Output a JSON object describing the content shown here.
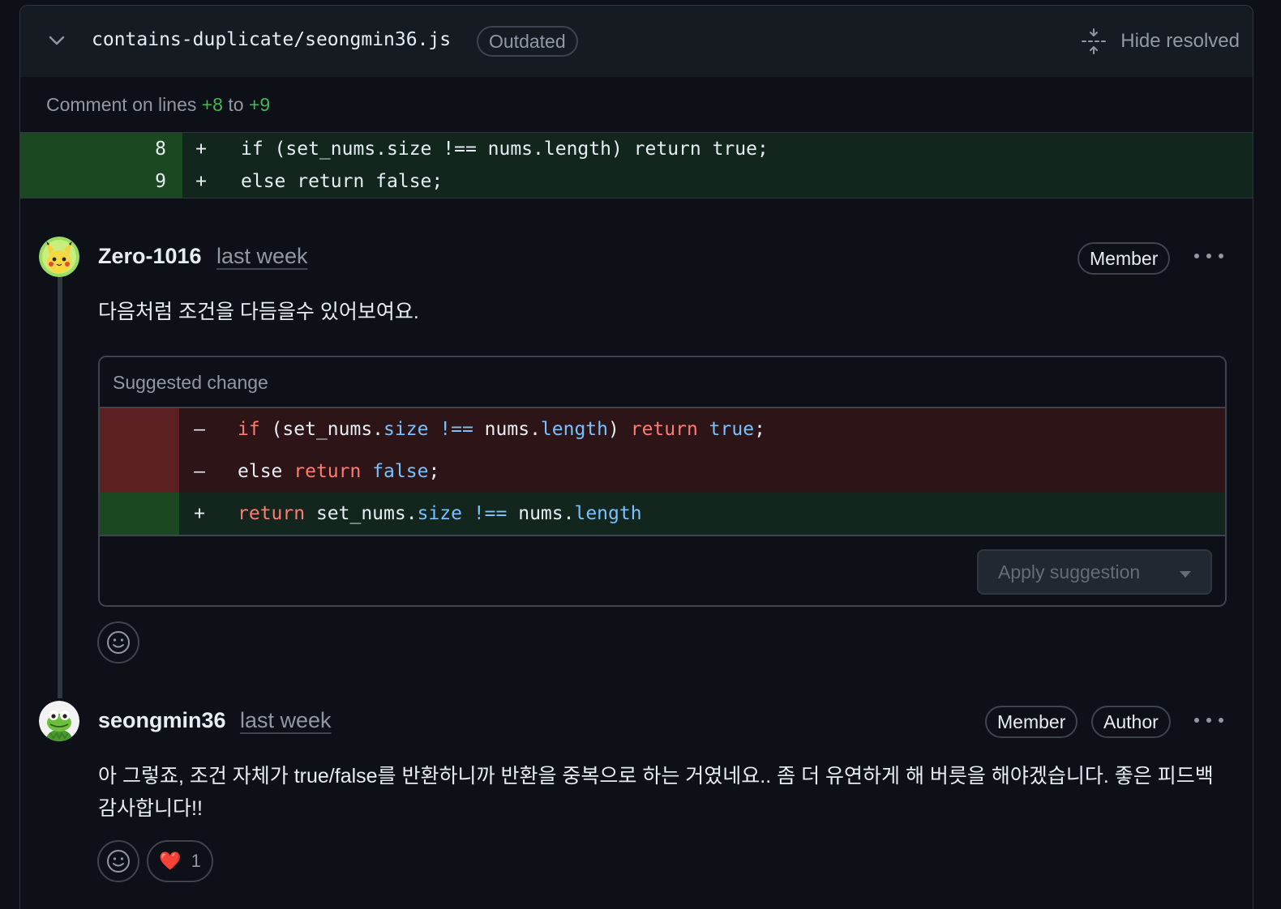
{
  "file_header": {
    "file_name": "contains-duplicate/seongmin36.js",
    "outdated_label": "Outdated",
    "hide_resolved_label": "Hide resolved"
  },
  "comment_on": {
    "prefix": "Comment on lines ",
    "from": "+8",
    "middle": " to ",
    "to": "+9"
  },
  "diff_lines": [
    {
      "num": "8",
      "sign": "+",
      "code": "if (set_nums.size !== nums.length) return true;"
    },
    {
      "num": "9",
      "sign": "+",
      "code": "else return false;"
    }
  ],
  "comments": [
    {
      "author": "Zero-1016",
      "time": "last week",
      "badges": [
        "Member"
      ],
      "body": "다음처럼 조건을 다듬을수 있어보여요."
    },
    {
      "author": "seongmin36",
      "time": "last week",
      "badges": [
        "Member",
        "Author"
      ],
      "body": "아 그렇죠, 조건 자체가 true/false를 반환하니까 반환을 중복으로 하는 거였네요.. 좀 더 유연하게 해 버릇을 해야겠습니다. 좋은 피드백 감사합니다!!"
    }
  ],
  "suggestion": {
    "title": "Suggested change",
    "apply_label": "Apply suggestion",
    "lines": [
      {
        "type": "del",
        "sign": "–",
        "tokens": [
          {
            "t": "if",
            "c": "k"
          },
          {
            "t": " (set_nums.",
            "c": ""
          },
          {
            "t": "size",
            "c": "p"
          },
          {
            "t": " ",
            "c": ""
          },
          {
            "t": "!==",
            "c": "p"
          },
          {
            "t": " nums.",
            "c": ""
          },
          {
            "t": "length",
            "c": "p"
          },
          {
            "t": ") ",
            "c": ""
          },
          {
            "t": "return",
            "c": "k"
          },
          {
            "t": " ",
            "c": ""
          },
          {
            "t": "true",
            "c": "p"
          },
          {
            "t": ";",
            "c": ""
          }
        ]
      },
      {
        "type": "del",
        "sign": "–",
        "tokens": [
          {
            "t": "else ",
            "c": ""
          },
          {
            "t": "return",
            "c": "k"
          },
          {
            "t": " ",
            "c": ""
          },
          {
            "t": "false",
            "c": "p"
          },
          {
            "t": ";",
            "c": ""
          }
        ]
      },
      {
        "type": "add",
        "sign": "+",
        "tokens": [
          {
            "t": "return",
            "c": "k"
          },
          {
            "t": " set_nums.",
            "c": ""
          },
          {
            "t": "size",
            "c": "p"
          },
          {
            "t": " ",
            "c": ""
          },
          {
            "t": "!==",
            "c": "p"
          },
          {
            "t": " nums.",
            "c": ""
          },
          {
            "t": "length",
            "c": "p"
          }
        ]
      }
    ]
  },
  "reactions": {
    "heart_emoji": "❤️",
    "heart_count": "1"
  }
}
